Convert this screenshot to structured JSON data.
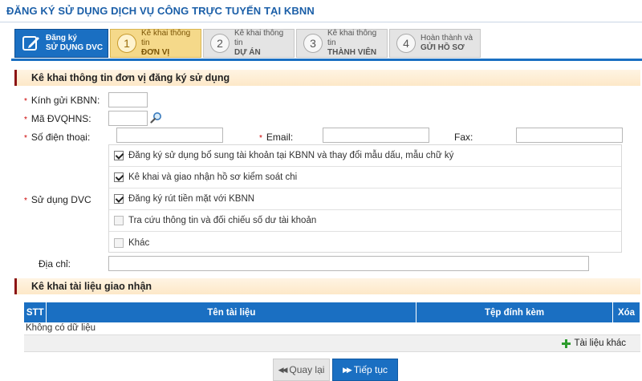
{
  "title": "ĐĂNG KÝ SỬ DỤNG DỊCH VỤ CÔNG TRỰC TUYẾN TẠI KBNN",
  "steps": [
    {
      "num": "",
      "line1": "Đăng ký",
      "line2": "SỬ DỤNG DVC",
      "state": "done"
    },
    {
      "num": "1",
      "line1": "Kê khai thông tin",
      "line2": "ĐƠN VỊ",
      "state": "active"
    },
    {
      "num": "2",
      "line1": "Kê khai thông tin",
      "line2": "DỰ ÁN",
      "state": "pending"
    },
    {
      "num": "3",
      "line1": "Kê khai thông tin",
      "line2": "THÀNH VIÊN",
      "state": "pending"
    },
    {
      "num": "4",
      "line1": "Hoàn thành và",
      "line2": "GỬI HỒ SƠ",
      "state": "pending"
    }
  ],
  "section1": {
    "title": "Kê khai thông tin đơn vị đăng ký sử dụng",
    "kbnn_label": "Kính gửi KBNN:",
    "kbnn_value": "",
    "dvqhns_label": "Mã ĐVQHNS:",
    "dvqhns_value": "",
    "phone_label": "Số điện thoại:",
    "phone_value": "",
    "email_label": "Email:",
    "email_value": "",
    "fax_label": "Fax:",
    "fax_value": "",
    "dvc_label": "Sử dụng DVC",
    "services": [
      {
        "label": "Đăng ký sử dụng bổ sung tài khoản tại KBNN và thay đổi mẫu dấu, mẫu chữ ký",
        "checked": true
      },
      {
        "label": "Kê khai và giao nhận hồ sơ kiểm soát chi",
        "checked": true
      },
      {
        "label": "Đăng ký rút tiền mặt với KBNN",
        "checked": true
      },
      {
        "label": "Tra cứu thông tin và đối chiếu số dư tài khoản",
        "checked": false
      },
      {
        "label": "Khác",
        "checked": false
      }
    ],
    "address_label": "Địa chỉ:",
    "address_value": ""
  },
  "section2": {
    "title": "Kê khai tài liệu giao nhận",
    "columns": [
      "STT",
      "Tên tài liệu",
      "Tệp đính kèm",
      "Xóa"
    ],
    "empty_text": "Không có dữ liệu",
    "add_label": "Tài liệu khác"
  },
  "buttons": {
    "back": "Quay lại",
    "next": "Tiếp tục"
  },
  "colors": {
    "primary": "#1a6fc2",
    "active_step": "#f5d98a",
    "section_bar": "#8b1414"
  }
}
